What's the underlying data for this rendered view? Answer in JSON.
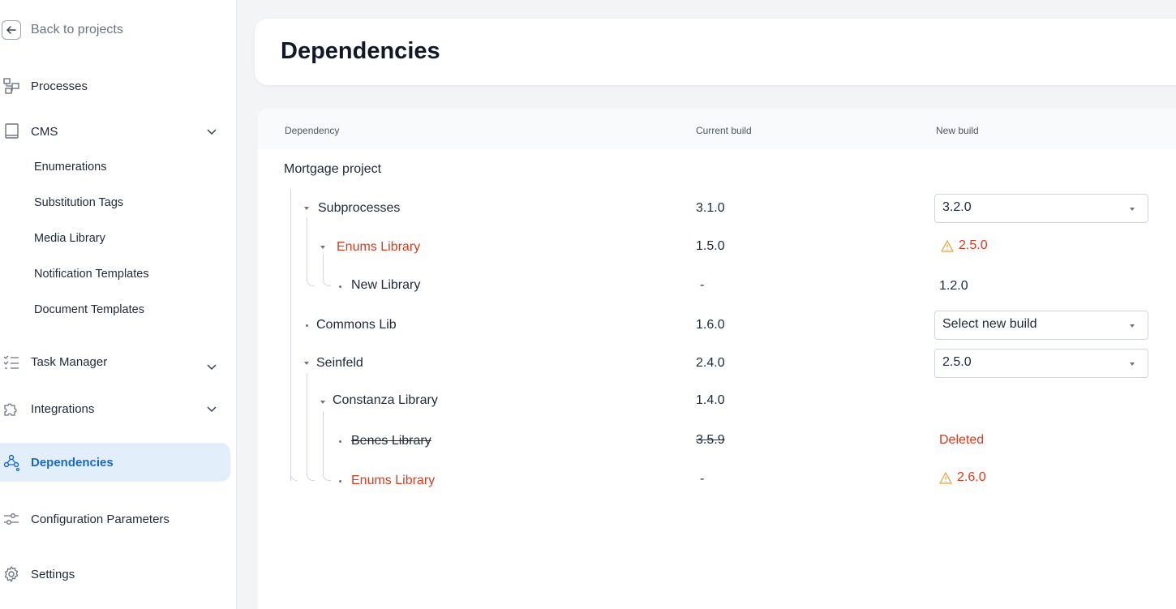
{
  "sidebar": {
    "back_label": "Back to projects",
    "items": {
      "processes": "Processes",
      "cms": "CMS",
      "cms_children": [
        "Enumerations",
        "Substitution Tags",
        "Media Library",
        "Notification Templates",
        "Document Templates"
      ],
      "task_manager": "Task Manager",
      "integrations": "Integrations",
      "dependencies": "Dependencies",
      "config_params": "Configuration Parameters",
      "settings": "Settings"
    },
    "icons": [
      "back-arrow-icon",
      "processes-icon",
      "book-icon",
      "checklist-icon",
      "puzzle-icon",
      "dependencies-icon",
      "sliders-icon",
      "gear-icon"
    ],
    "accent_color": "#1968c7"
  },
  "page": {
    "title": "Dependencies"
  },
  "table": {
    "headers": {
      "dependency": "Dependency",
      "current": "Current build",
      "new": "New build"
    },
    "root": "Mortgage project",
    "rows": [
      {
        "name": "Subprocesses",
        "current": "3.1.0",
        "new_select": "3.2.0"
      },
      {
        "name": "Enums Library",
        "current": "1.5.0",
        "new_warn": "2.5.0"
      },
      {
        "name": "New Library",
        "current": "-",
        "new_text": "1.2.0"
      },
      {
        "name": "Commons Lib",
        "current": "1.6.0",
        "new_select": "Select new build"
      },
      {
        "name": "Seinfeld",
        "current": "2.4.0",
        "new_select": "2.5.0"
      },
      {
        "name": "Constanza Library",
        "current": "1.4.0"
      },
      {
        "name": "Benes Library",
        "current": "3.5.9",
        "new_deleted": "Deleted"
      },
      {
        "name": "Enums Library",
        "current": "-",
        "new_warn": "2.6.0"
      }
    ],
    "colors": {
      "error": "#d93a1e",
      "warning": "#e9a23b"
    }
  }
}
